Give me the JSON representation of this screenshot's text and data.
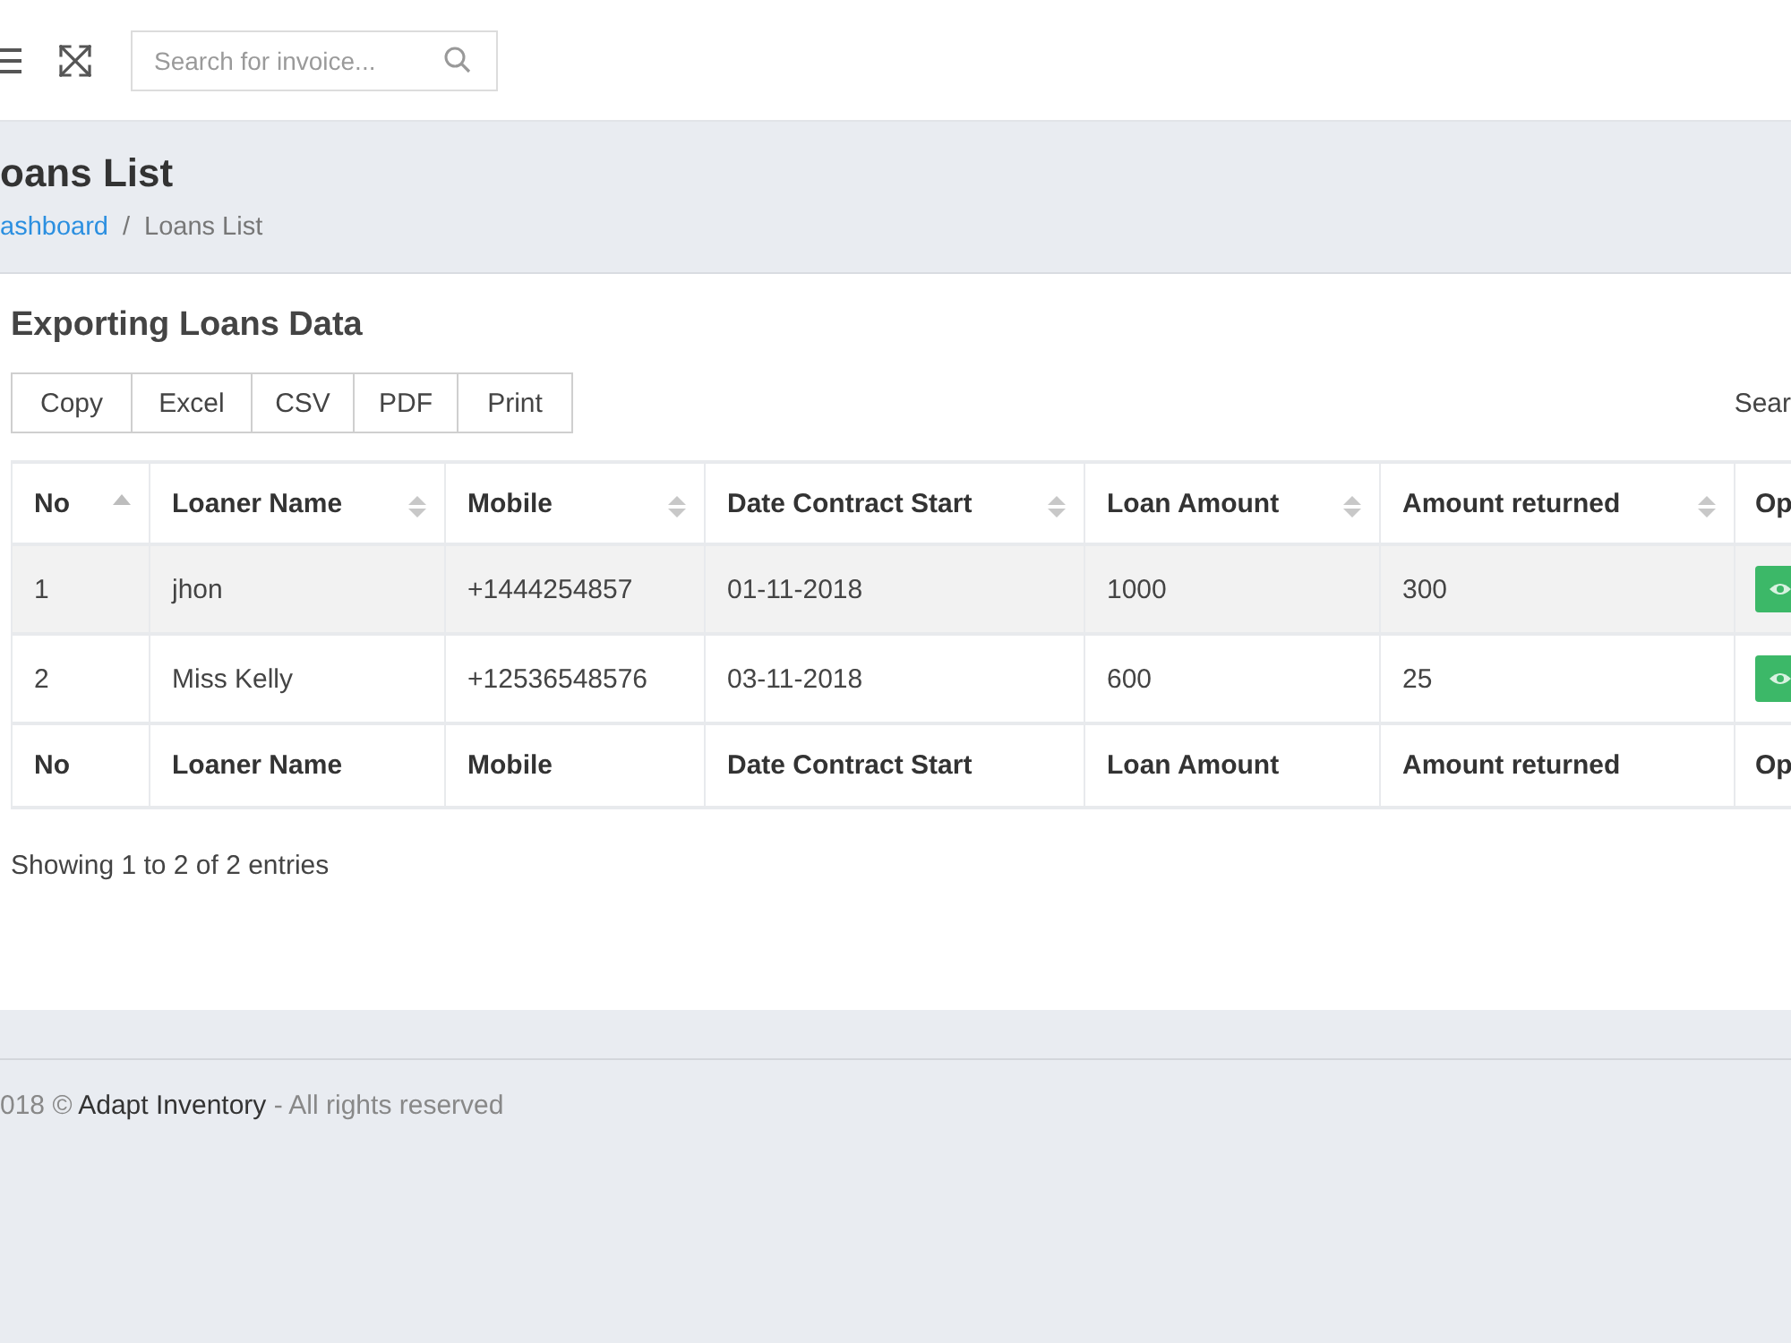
{
  "topbar": {
    "search": {
      "placeholder": "Search for invoice..."
    }
  },
  "page_header": {
    "title": "oans List",
    "breadcrumb": [
      {
        "label": "ashboard",
        "kind": "link"
      },
      {
        "label": "/",
        "kind": "separator"
      },
      {
        "label": "Loans List",
        "kind": "current"
      }
    ]
  },
  "card": {
    "title": "Exporting Loans Data",
    "export_buttons": [
      "Copy",
      "Excel",
      "CSV",
      "PDF",
      "Print"
    ],
    "search_label": "Sear",
    "table": {
      "columns": [
        {
          "label": "No",
          "sorted": true
        },
        {
          "label": "Loaner Name",
          "sorted": false
        },
        {
          "label": "Mobile",
          "sorted": false
        },
        {
          "label": "Date Contract Start",
          "sorted": false
        },
        {
          "label": "Loan Amount",
          "sorted": false
        },
        {
          "label": "Amount returned",
          "sorted": false
        },
        {
          "label": "Op"
        }
      ],
      "rows": [
        {
          "cells": [
            "1",
            "jhon",
            "+1444254857",
            "01-11-2018",
            "1000",
            "300"
          ],
          "actions": [
            {
              "kind": "view"
            }
          ]
        },
        {
          "cells": [
            "2",
            "Miss Kelly",
            "+12536548576",
            "03-11-2018",
            "600",
            "25"
          ],
          "actions": [
            {
              "kind": "view"
            }
          ]
        }
      ],
      "footer": [
        "No",
        "Loaner Name",
        "Mobile",
        "Date Contract Start",
        "Loan Amount",
        "Amount returned",
        "Op"
      ]
    },
    "info": "Showing 1 to 2 of 2 entries"
  },
  "footer": {
    "before": "018 © ",
    "brand": "Adapt Inventory",
    "after": " - All rights reserved"
  }
}
